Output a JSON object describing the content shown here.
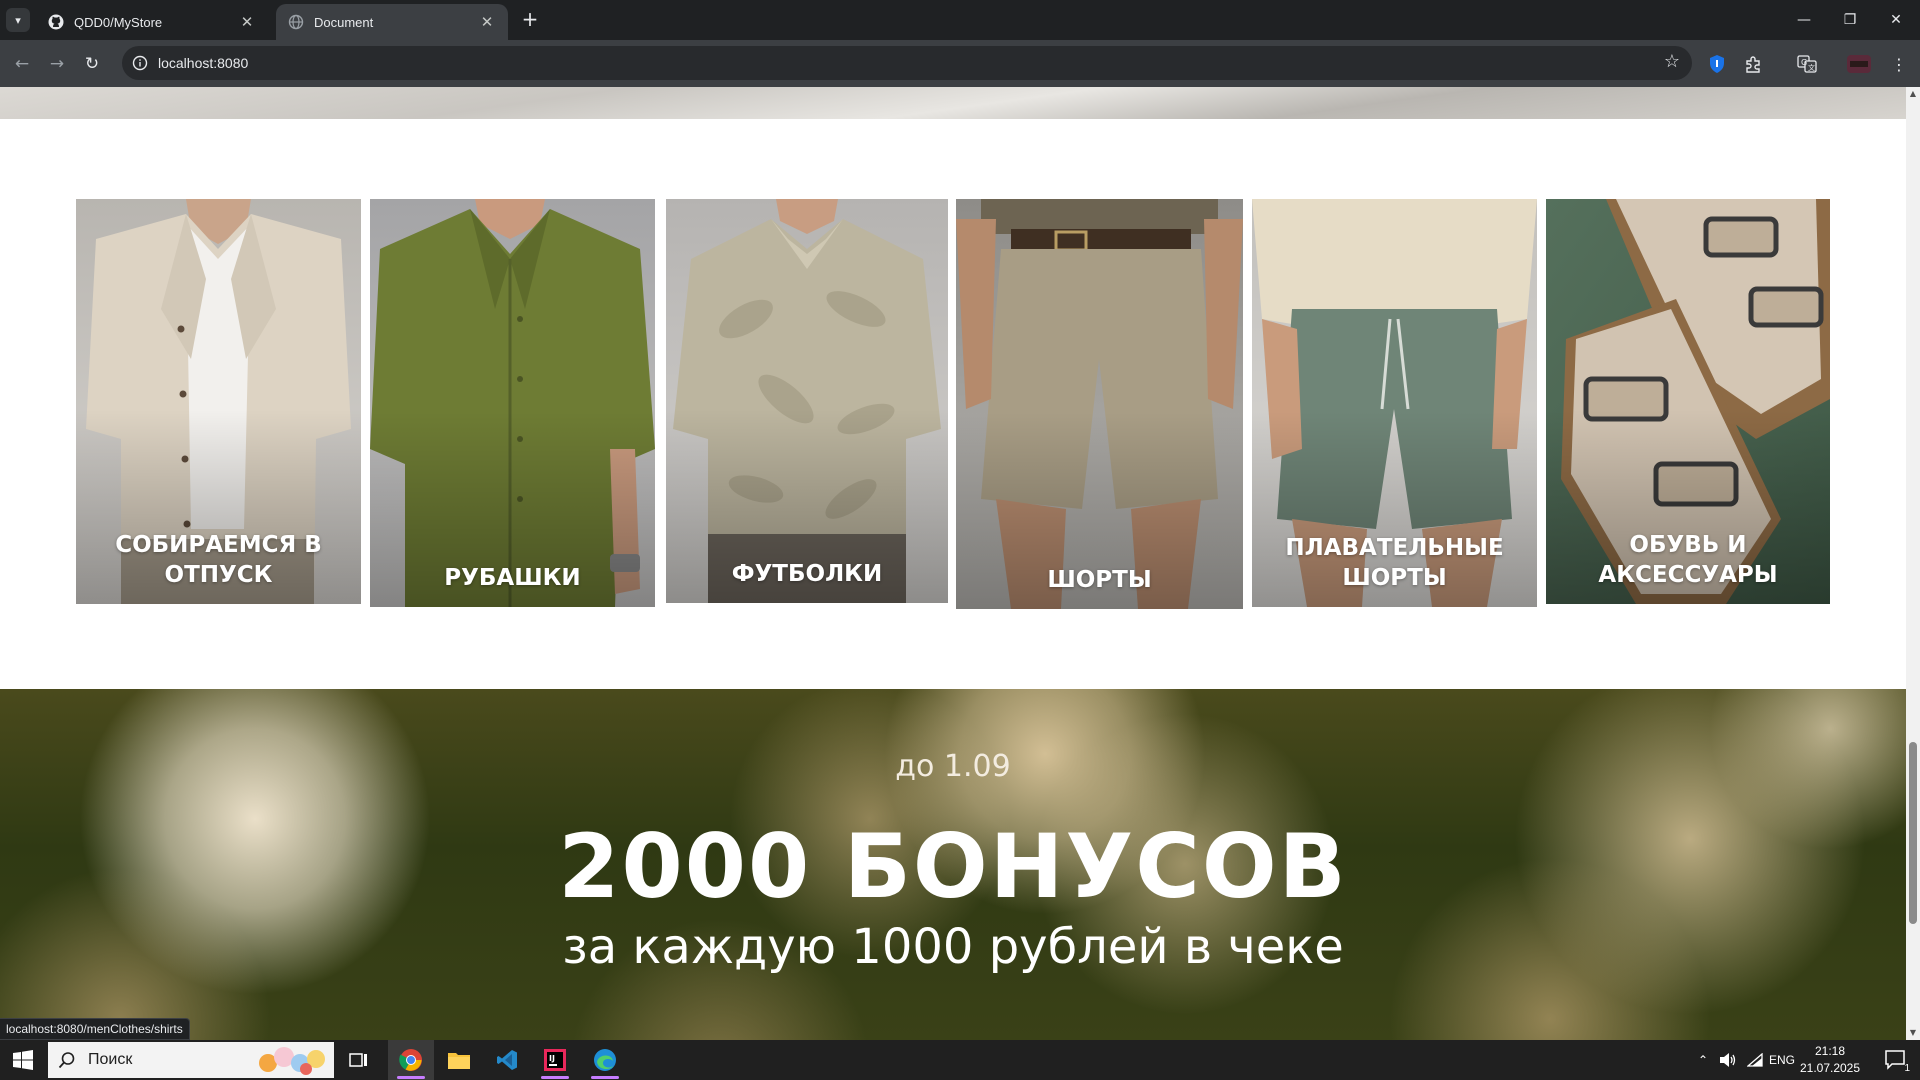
{
  "browser": {
    "tabs": [
      {
        "title": "QDD0/MyStore",
        "favicon": "github-icon",
        "active": false
      },
      {
        "title": "Document",
        "favicon": "globe-icon",
        "active": true
      }
    ],
    "url": "localhost:8080"
  },
  "categories": [
    {
      "label": "СОБИРАЕМСЯ В ОТПУСК"
    },
    {
      "label": "РУБАШКИ"
    },
    {
      "label": "ФУТБОЛКИ"
    },
    {
      "label": "ШОРТЫ"
    },
    {
      "label": "ПЛАВАТЕЛЬНЫЕ ШОРТЫ"
    },
    {
      "label": "ОБУВЬ И АКСЕССУАРЫ"
    }
  ],
  "promo": {
    "date": "до 1.09",
    "headline": "2000 БОНУСОВ",
    "subline": "за каждую 1000 рублей в чеке"
  },
  "status_bar": {
    "link": "localhost:8080/menClothes/shirts"
  },
  "taskbar": {
    "search_placeholder": "Поиск",
    "language": "ENG",
    "time": "21:18",
    "date": "21.07.2025",
    "notification_count": "1"
  },
  "colors": {
    "chrome_dark": "#1f2123",
    "chrome_toolbar": "#3c3f43",
    "promo_text": "#ffffff"
  }
}
